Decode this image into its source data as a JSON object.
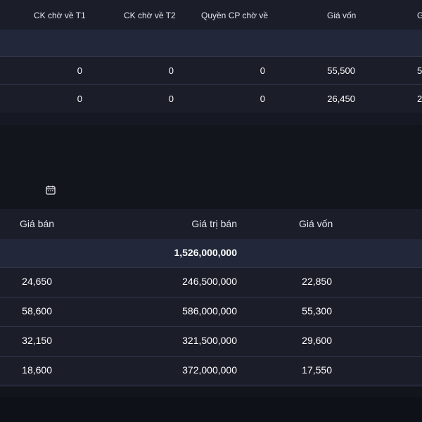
{
  "top_table": {
    "headers": [
      "CK chờ về T1",
      "CK chờ về T2",
      "Quyền CP chờ về",
      "Giá vốn",
      "G"
    ],
    "rows": [
      [
        "0",
        "0",
        "0",
        "55,500",
        "5"
      ],
      [
        "0",
        "0",
        "0",
        "26,450",
        "2"
      ]
    ]
  },
  "bottom_table": {
    "headers": [
      "Giá bán",
      "Giá trị bán",
      "Giá vốn"
    ],
    "summary": {
      "value": "1,526,000,000"
    },
    "rows": [
      [
        "24,650",
        "246,500,000",
        "22,850"
      ],
      [
        "58,600",
        "586,000,000",
        "55,300"
      ],
      [
        "32,150",
        "321,500,000",
        "29,600"
      ],
      [
        "18,600",
        "372,000,000",
        "17,550"
      ]
    ]
  },
  "icons": {
    "date_filter": "calendar-icon"
  }
}
